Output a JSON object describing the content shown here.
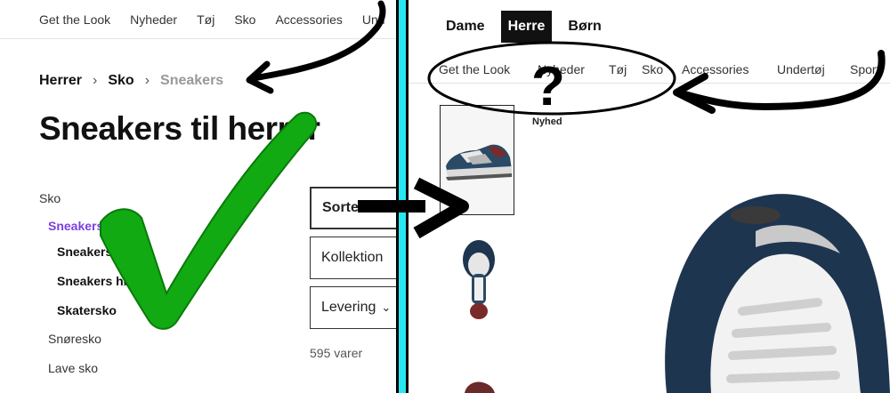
{
  "left": {
    "top_nav": [
      "Get the Look",
      "Nyheder",
      "Tøj",
      "Sko",
      "Accessories",
      "Und"
    ],
    "breadcrumb": {
      "level1": "Herrer",
      "level2": "Sko",
      "current": "Sneakers"
    },
    "title": "Sneakers til herrer",
    "categories": [
      {
        "label": "Sko"
      },
      {
        "label": "Sneakers"
      },
      {
        "label": "Sneakers"
      },
      {
        "label": "Sneakers høje"
      },
      {
        "label": "Skatersko"
      },
      {
        "label": "Snøresko"
      },
      {
        "label": "Lave sko"
      }
    ],
    "filters": {
      "sort": "Sorter",
      "collection": "Kollektion",
      "delivery": "Levering"
    },
    "count": "595 varer"
  },
  "right": {
    "gender_tabs": [
      "Dame",
      "Herre",
      "Børn"
    ],
    "nav": [
      "Get the Look",
      "Nyheder",
      "Tøj",
      "Sko",
      "Accessories",
      "Undertøj",
      "Sport"
    ],
    "badge": "Nyhed"
  },
  "annotation": {
    "question_mark": "?"
  },
  "colors": {
    "active_category": "#7b3fe4",
    "divider": "#27e8f2",
    "checkmark": "#12aa12"
  }
}
